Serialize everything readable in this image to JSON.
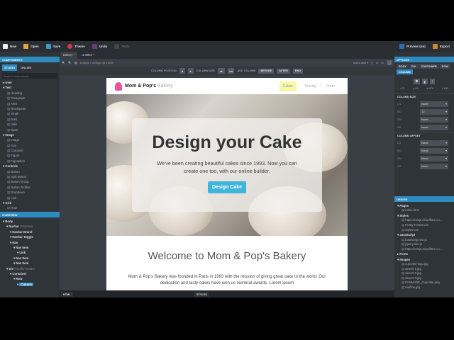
{
  "toolbar": {
    "new": "New",
    "open": "Open",
    "save": "Save",
    "theme": "Theme",
    "undo": "Undo",
    "redo": "Redo",
    "preview": "Preview (on)",
    "export": "Export"
  },
  "components": {
    "title": "COMPONENTS",
    "tabs": [
      "STUDIO",
      "ONLINE"
    ],
    "search_placeholder": "Search components",
    "groups": [
      {
        "name": "User",
        "items": []
      },
      {
        "name": "Text",
        "items": [
          "Heading",
          "Paragraph",
          "Alert",
          "Blockquote",
          "Small",
          "Bold",
          "Italic",
          "Span"
        ]
      },
      {
        "name": "Image",
        "items": [
          "Image",
          "Icon",
          "Carousel",
          "Figure",
          "Figcaption"
        ]
      },
      {
        "name": "Controls",
        "items": [
          "Button",
          "Split Button",
          "Button Group",
          "Button Toolbar",
          "Dropdown",
          "Link"
        ]
      },
      {
        "name": "Grid",
        "items": [
          "Row"
        ]
      }
    ]
  },
  "overview": {
    "title": "OVERVIEW",
    "nodes": [
      {
        "label": "Body",
        "depth": 0
      },
      {
        "label": "Navbar",
        "note": "#mainnav",
        "depth": 1
      },
      {
        "label": "Navbar Brand",
        "depth": 2
      },
      {
        "label": "Navbar Toggle",
        "depth": 2
      },
      {
        "label": "Nav",
        "depth": 2
      },
      {
        "label": "Nav Item",
        "depth": 3
      },
      {
        "label": "Link",
        "depth": 4
      },
      {
        "label": "Nav Item",
        "depth": 3
      },
      {
        "label": "Nav Item",
        "depth": 3
      },
      {
        "label": "Div",
        "note": "#muffin-header",
        "depth": 1
      },
      {
        "label": "Container",
        "depth": 2
      },
      {
        "label": "Row",
        "depth": 3
      },
      {
        "label": "Column",
        "depth": 4,
        "selected": true
      }
    ]
  },
  "editor": {
    "tabs": [
      "Bakery *",
      "Untitled *"
    ],
    "size_readout": "1100px × 2290px @ 100%",
    "file": "index.html",
    "column_position": "COLUMN POSITION",
    "column_size": "COLUMN SIZE",
    "add_column": "ADD COLUMN",
    "before": "BEFORE",
    "after": "AFTER",
    "end": "END",
    "bottom": {
      "html": "HTML",
      "styles": "STYLES"
    }
  },
  "site": {
    "brand_bold": "Mom & Pop's",
    "brand_light": "Bakery",
    "nav": [
      "Cakes",
      "Pricing",
      "Order"
    ],
    "active_nav": "Cakes",
    "hero_title": "Design your Cake",
    "hero_text": "We've been creating beautiful cakes since 1993. Now you can create one too, with our online builder.",
    "hero_button": "Design Cake",
    "welcome": "Welcome to Mom & Pop's Bakery",
    "about": "Mom & Pop's Bakery was founded in Paris in 1993 with the mission of giving great cake to the world. Our dedication and tasty cakes have won us numeral awards. Lorem ipsum"
  },
  "options": {
    "title": "OPTIONS",
    "crumbs": [
      "BODY",
      "DIV",
      "CONTAINER",
      "ROW",
      "COLUMN"
    ],
    "dims": [
      "x 27",
      "y 64",
      "w 876",
      "h 886"
    ],
    "column_size": {
      "title": "COLUMN SIZE",
      "rows": [
        [
          "LG",
          "None"
        ],
        [
          "MD",
          "12"
        ],
        [
          "SM",
          "None"
        ],
        [
          "XS",
          "None"
        ]
      ]
    },
    "column_offset": {
      "title": "COLUMN OFFSET",
      "rows": [
        [
          "LG",
          "None"
        ],
        [
          "MD",
          "None"
        ],
        [
          "SM",
          "None"
        ],
        [
          "XS",
          "None"
        ]
      ]
    }
  },
  "design": {
    "title": "DESIGN",
    "groups": [
      {
        "name": "Pages",
        "items": [
          "index.html"
        ]
      },
      {
        "name": "Styles",
        "items": [
          "https://cdnjs.cloudflare.co...",
          "Pretty-Footer.css",
          "styles.css"
        ]
      },
      {
        "name": "JavaScript",
        "items": [
          "bootstrap.min.js",
          "jquery.min.js",
          "https://cdnjs.cloudflare.co..."
        ]
      },
      {
        "name": "Fonts",
        "items": []
      },
      {
        "name": "Images",
        "items": [
          "cupcake-logo.jpg",
          "desert-1.jpg",
          "desert-2.jpg",
          "desert-3.jpg",
          "FANMADE_Cupcake.png",
          "muffins.jpg"
        ]
      }
    ]
  },
  "colors": {
    "accent": "#2e8bc0",
    "hero_button": "#3fb5dc",
    "active_nav": "#f7f7a8"
  }
}
